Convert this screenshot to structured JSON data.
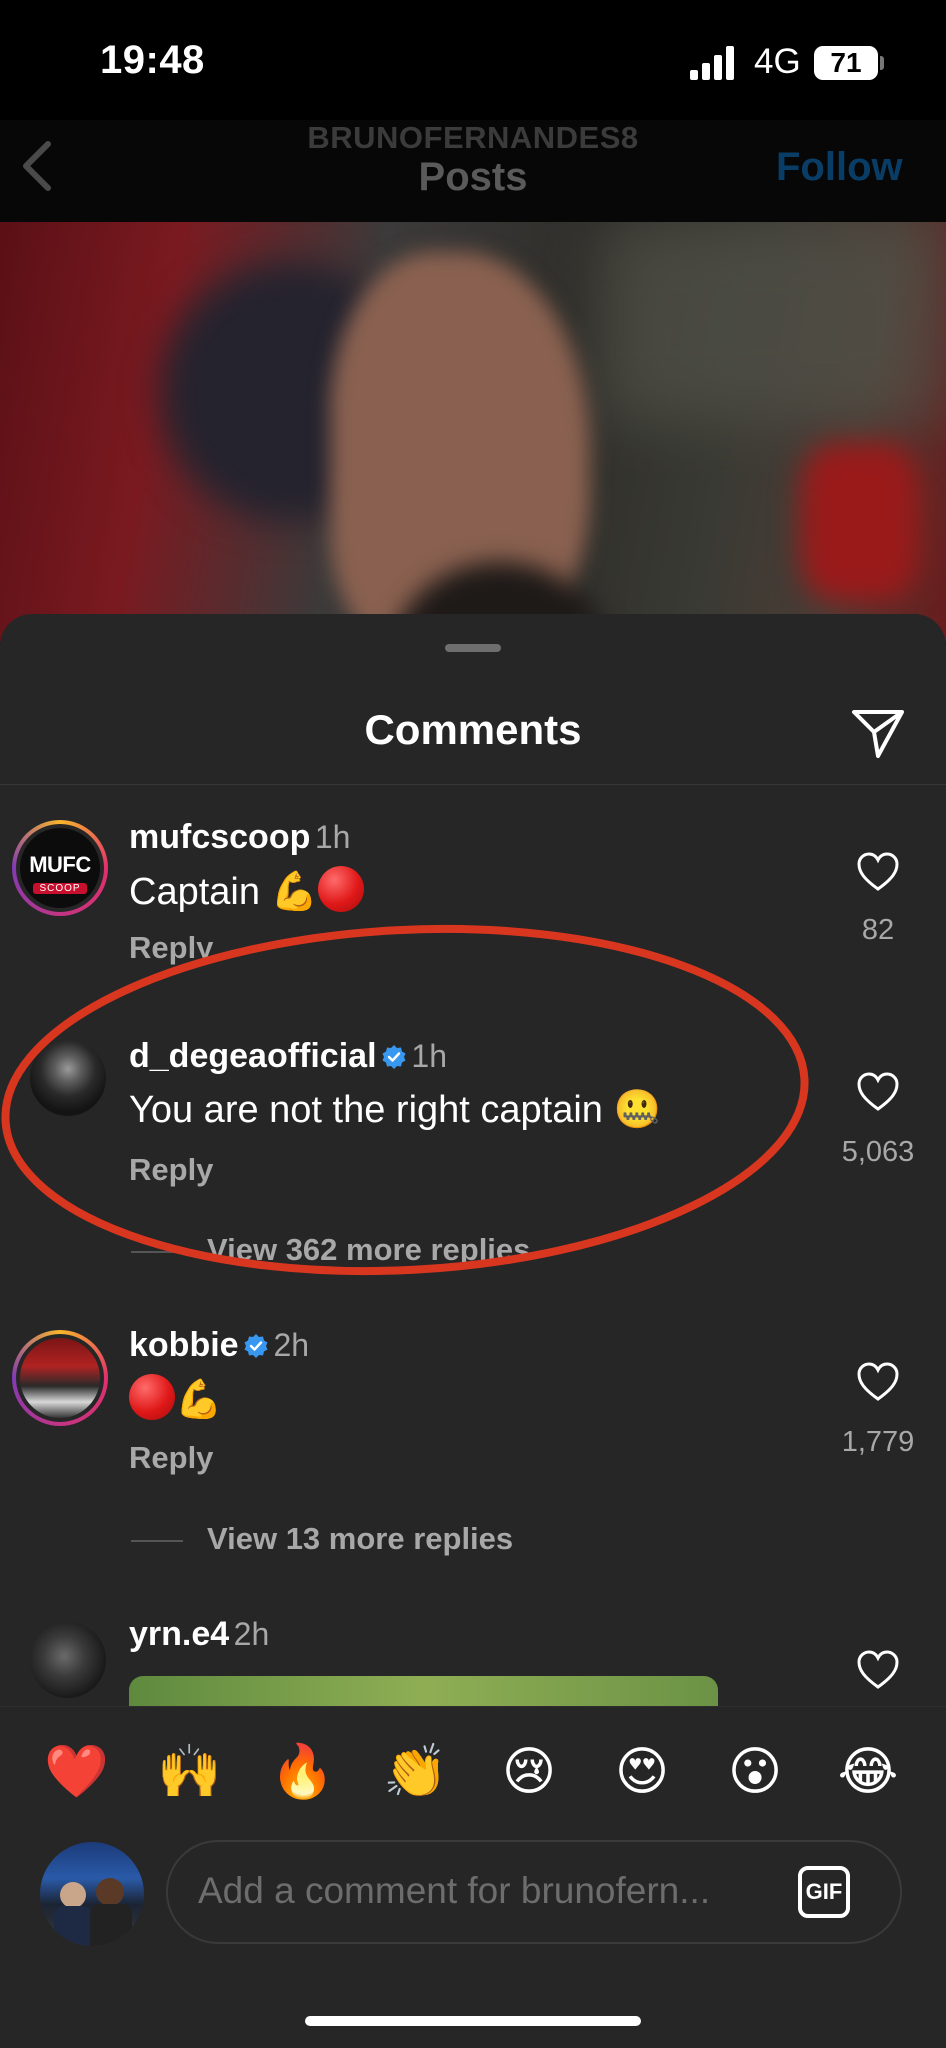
{
  "status_bar": {
    "time": "19:48",
    "network": "4G",
    "battery": "71"
  },
  "nav": {
    "account": "BRUNOFERNANDES8",
    "title": "Posts",
    "follow": "Follow"
  },
  "comments_sheet": {
    "title": "Comments"
  },
  "comments": [
    {
      "username": "mufcscoop",
      "time": "1h",
      "text": "Captain 💪",
      "reply": "Reply",
      "likes": "82",
      "avatar_text": "MUFC",
      "avatar_sub": "SCOOP"
    },
    {
      "username": "d_degeaofficial",
      "time": "1h",
      "text": "You are not the right captain 🤐",
      "reply": "Reply",
      "likes": "5,063",
      "view_more": "View 362 more replies",
      "verified": true
    },
    {
      "username": "kobbie",
      "time": "2h",
      "text": "💪",
      "reply": "Reply",
      "likes": "1,779",
      "view_more": "View 13 more replies",
      "verified": true
    },
    {
      "username": "yrn.e4",
      "time": "2h"
    }
  ],
  "reaction_emojis": [
    "❤️",
    "🙌",
    "🔥",
    "👏",
    "😢",
    "😍",
    "😮",
    "😂"
  ],
  "comment_input": {
    "placeholder": "Add a comment for brunofern...",
    "gif_label": "GIF"
  },
  "colors": {
    "accent_blue": "#3897f0",
    "annotation_red": "#d9361f",
    "sheet_bg": "#262626"
  }
}
